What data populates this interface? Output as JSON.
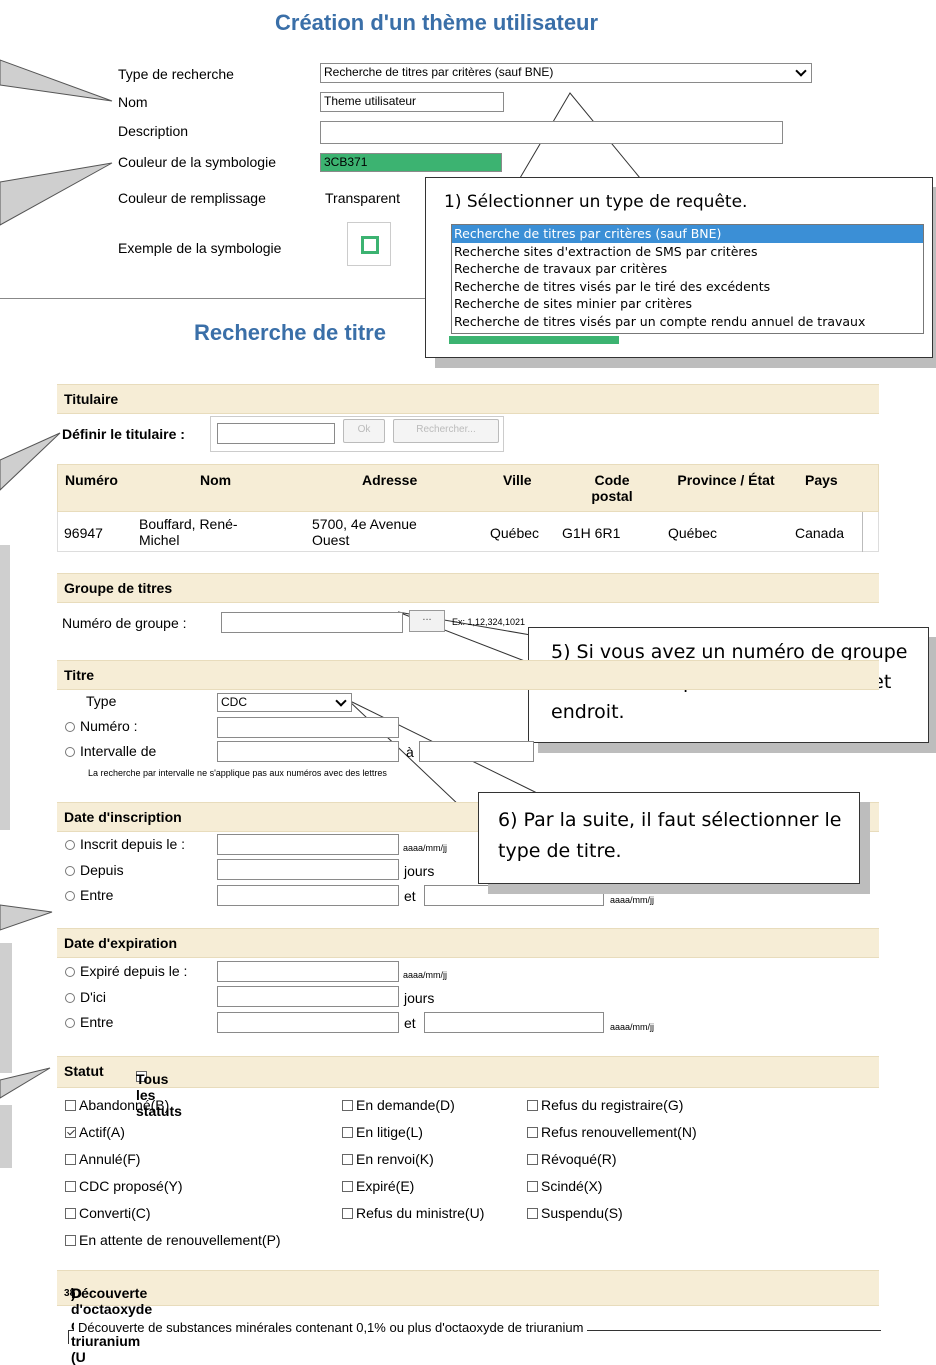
{
  "header": {
    "title": "Création d'un thème utilisateur"
  },
  "theme_form": {
    "type_label": "Type de recherche",
    "type_value": "Recherche de titres par critères (sauf BNE)",
    "name_label": "Nom",
    "name_value": "Theme utilisateur",
    "description_label": "Description",
    "description_value": "",
    "symbol_color_label": "Couleur de la symbologie",
    "symbol_color_value": "3CB371",
    "fill_color_label": "Couleur de remplissage",
    "fill_color_value": "Transparent",
    "symbol_example_label": "Exemple de la symbologie",
    "symbol_color_hex": "#3cb371"
  },
  "callout1": {
    "text": "1) Sélectionner un type de requête.",
    "options": [
      "Recherche de titres par critères (sauf BNE)",
      "Recherche sites d'extraction de SMS par critères",
      "Recherche de travaux par critères",
      "Recherche de titres visés par le tiré des excédents",
      "Recherche de sites minier par critères",
      "Recherche de titres visés par un compte rendu annuel de travaux"
    ]
  },
  "search_title": "Recherche de titre",
  "titulaire": {
    "section": "Titulaire",
    "define_label": "Définir le titulaire :",
    "ok_label": "Ok",
    "search_label": "Rechercher...",
    "columns": [
      "Numéro",
      "Nom",
      "Adresse",
      "Ville",
      "Code postal",
      "Province / État",
      "Pays"
    ],
    "row": {
      "numero": "96947",
      "nom": "Bouffard, René-Michel",
      "adresse": "5700, 4e Avenue Ouest",
      "ville": "Québec",
      "code": "G1H 6R1",
      "province": "Québec",
      "pays": "Canada"
    }
  },
  "groupe": {
    "section": "Groupe de titres",
    "label": "Numéro de groupe :",
    "button": "...",
    "example": "Ex: 1,12,324,1021"
  },
  "callout5": {
    "text": "5) Si vous avez un numéro de groupe de titre, vous pouvez l'inscrire à cet endroit."
  },
  "titre": {
    "section": "Titre",
    "type_label": "Type",
    "type_value": "CDC",
    "numero_label": "Numéro :",
    "intervalle_label": "Intervalle de",
    "a_label": "à",
    "note": "La recherche par intervalle ne s'applique pas aux numéros avec des lettres"
  },
  "callout6": {
    "text": "6) Par la suite, il faut sélectionner le type de titre."
  },
  "inscription": {
    "section": "Date d'inscription",
    "opt1": "Inscrit depuis le :",
    "opt2": "Depuis",
    "opt3": "Entre",
    "fmt": "aaaa/mm/jj",
    "jours": "jours",
    "et": "et"
  },
  "expiration": {
    "section": "Date d'expiration",
    "opt1": "Expiré depuis le :",
    "opt2": "D'ici",
    "opt3": "Entre",
    "fmt": "aaaa/mm/jj",
    "jours": "jours",
    "et": "et"
  },
  "statut": {
    "section": "Statut",
    "all_label": "Tous les statuts",
    "items": [
      {
        "label": "Abandonné(B)",
        "checked": false
      },
      {
        "label": "Actif(A)",
        "checked": true
      },
      {
        "label": "Annulé(F)",
        "checked": false
      },
      {
        "label": "CDC proposé(Y)",
        "checked": false
      },
      {
        "label": "Converti(C)",
        "checked": false
      },
      {
        "label": "En attente de renouvellement(P)",
        "checked": false
      },
      {
        "label": "En demande(D)",
        "checked": false
      },
      {
        "label": "En litige(L)",
        "checked": false
      },
      {
        "label": "En renvoi(K)",
        "checked": false
      },
      {
        "label": "Expiré(E)",
        "checked": false
      },
      {
        "label": "Refus du ministre(U)",
        "checked": false
      },
      {
        "label": "Refus du registraire(G)",
        "checked": false
      },
      {
        "label": "Refus renouvellement(N)",
        "checked": false
      },
      {
        "label": "Révoqué(R)",
        "checked": false
      },
      {
        "label": "Scindé(X)",
        "checked": false
      },
      {
        "label": "Suspendu(S)",
        "checked": false
      }
    ]
  },
  "decouverte": {
    "section_pre": "Découverte d'octaoxyde de triuranium (U",
    "sub3": "3",
    "mid": "O",
    "sub8": "8",
    "post": ")",
    "fieldset": "Découverte de substances minérales contenant 0,1% ou plus d'octaoxyde de triuranium"
  }
}
